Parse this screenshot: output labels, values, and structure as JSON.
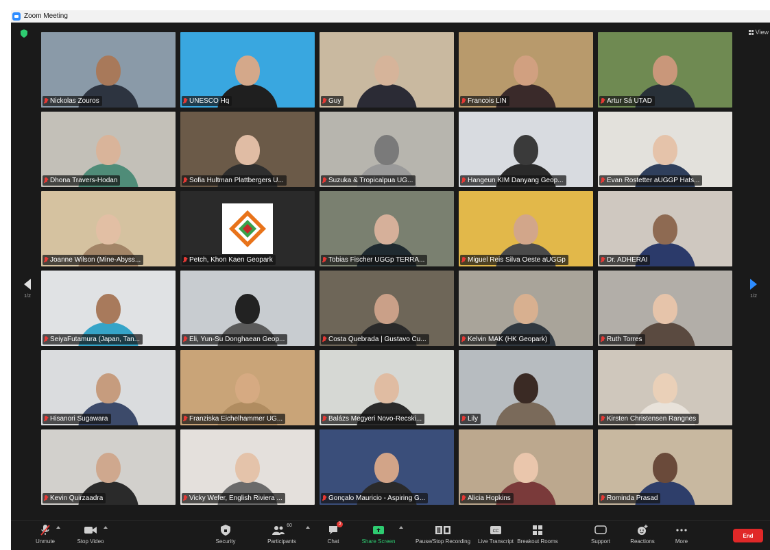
{
  "window": {
    "title": "Zoom Meeting"
  },
  "view_button": {
    "label": "View"
  },
  "pagination": {
    "left": "1/2",
    "right": "1/2"
  },
  "participants": [
    {
      "name": "Nickolas Zouros",
      "bg": "#8a9aa8",
      "head": "#a8795a",
      "body": "#2d3440",
      "active": true
    },
    {
      "name": "UNESCO Hq",
      "bg": "#39a7e0",
      "head": "#d4a88a",
      "body": "#1f1f1f"
    },
    {
      "name": "Guy",
      "bg": "#c9b9a0",
      "head": "#d6b49a",
      "body": "#2b2b35"
    },
    {
      "name": "Francois LIN",
      "bg": "#b89a6c",
      "head": "#d1a080",
      "body": "#3a2a2a"
    },
    {
      "name": "Artur Sá UTAD",
      "bg": "#6f8a52",
      "head": "#c9977a",
      "body": "#283038"
    },
    {
      "name": "Dhona Travers-Hodan",
      "bg": "#c3c0b8",
      "head": "#d9b49a",
      "body": "#4f8c78"
    },
    {
      "name": "Sofia Hultman Plattbergers U...",
      "bg": "#6b5a48",
      "head": "#e0bca4",
      "body": "#2e2e2e"
    },
    {
      "name": "Suzuka & Tropicalpua UG...",
      "bg": "#b7b5ae",
      "head": "#7a7a7a",
      "body": "#9a9a9a"
    },
    {
      "name": "Hangeun KIM Danyang Geop...",
      "bg": "#d8dbe0",
      "head": "#3a3a3a",
      "body": "#2a2a2a"
    },
    {
      "name": "Evan Rostetter aUGGP Hats...",
      "bg": "#e3e1dc",
      "head": "#e5c3aa",
      "body": "#2f3f5c"
    },
    {
      "name": "Joanne Wilson (Mine-Abyss...",
      "bg": "#d5c2a0",
      "head": "#e2bfa4",
      "body": "#a28466"
    },
    {
      "name": "Petch, Khon Kaen Geopark",
      "bg": "#2a2a2a",
      "logo": true
    },
    {
      "name": "Tobias Fischer UGGp TERRA...",
      "bg": "#7a8070",
      "head": "#d6b09a",
      "body": "#1f2a30"
    },
    {
      "name": "Miguel Reis Silva Oeste aUGGp",
      "bg": "#e2b84a",
      "head": "#d2a68a",
      "body": "#4a4a4a"
    },
    {
      "name": "Dr. ADHERAI",
      "bg": "#cfc8c0",
      "head": "#8e6a52",
      "body": "#2b3a6a"
    },
    {
      "name": "SeiyaFutamura (Japan, Tan...",
      "bg": "#e0e2e4",
      "head": "#a87a5c",
      "body": "#35a4c8"
    },
    {
      "name": "Eli, Yun-Su Donghaean Geop...",
      "bg": "#c8ccd0",
      "head": "#222222",
      "body": "#5a5a5a"
    },
    {
      "name": "Costa Quebrada | Gustavo Cu...",
      "bg": "#6e6658",
      "head": "#caa088",
      "body": "#2a2a2a"
    },
    {
      "name": "Kelvin MAK (HK Geopark)",
      "bg": "#a9a49a",
      "head": "#d8b090",
      "body": "#303840"
    },
    {
      "name": "Ruth Torres",
      "bg": "#b2aea8",
      "head": "#e6c4aa",
      "body": "#5a4a40"
    },
    {
      "name": "Hisanori Sugawara",
      "bg": "#dadcde",
      "head": "#c69c7e",
      "body": "#3c4a6a"
    },
    {
      "name": "Franziska Eichelhammer UG...",
      "bg": "#c9a478",
      "head": "#d6aa82",
      "body": "#b08c60"
    },
    {
      "name": "Balázs Megyeri Novo-Recski...",
      "bg": "#d6d8d4",
      "head": "#e0bca2",
      "body": "#2a2a2a"
    },
    {
      "name": "Lily",
      "bg": "#b7bcc0",
      "head": "#3a2a24",
      "body": "#7a6a5a"
    },
    {
      "name": "Kirsten Christensen Rangnes",
      "bg": "#cfc7bc",
      "head": "#ead0b8",
      "body": "#e8e2da"
    },
    {
      "name": "Kevin Quirzaadra",
      "bg": "#d2d0cc",
      "head": "#cfa88e",
      "body": "#2a2a2a"
    },
    {
      "name": "Vicky Wefer, English Riviera ...",
      "bg": "#e4e0dc",
      "head": "#e4c3aa",
      "body": "#6a6a6a"
    },
    {
      "name": "Gonçalo Mauricio - Aspiring G...",
      "bg": "#3a4e7a",
      "head": "#d2a488",
      "body": "#2a2a2a"
    },
    {
      "name": "Alicia Hopkins",
      "bg": "#bca88e",
      "head": "#eac6ac",
      "body": "#7a3a3a"
    },
    {
      "name": "Rominda Prasad",
      "bg": "#c8b8a0",
      "head": "#6a4a3a",
      "body": "#2e3e6a"
    }
  ],
  "toolbar": {
    "unmute": "Unmute",
    "stop_video": "Stop Video",
    "security": "Security",
    "participants": "Participants",
    "participants_count": "60",
    "chat": "Chat",
    "chat_badge": "3",
    "share_screen": "Share Screen",
    "recording": "Pause/Stop Recording",
    "live_transcript": "Live Transcript",
    "breakout_rooms": "Breakout Rooms",
    "support": "Support",
    "reactions": "Reactions",
    "more": "More",
    "end": "End"
  },
  "colors": {
    "zoom_blue": "#2D8CFF",
    "end_red": "#e02828",
    "muted_red": "#e53935",
    "share_green": "#2ecc71",
    "active_speaker": "#d8c244"
  }
}
